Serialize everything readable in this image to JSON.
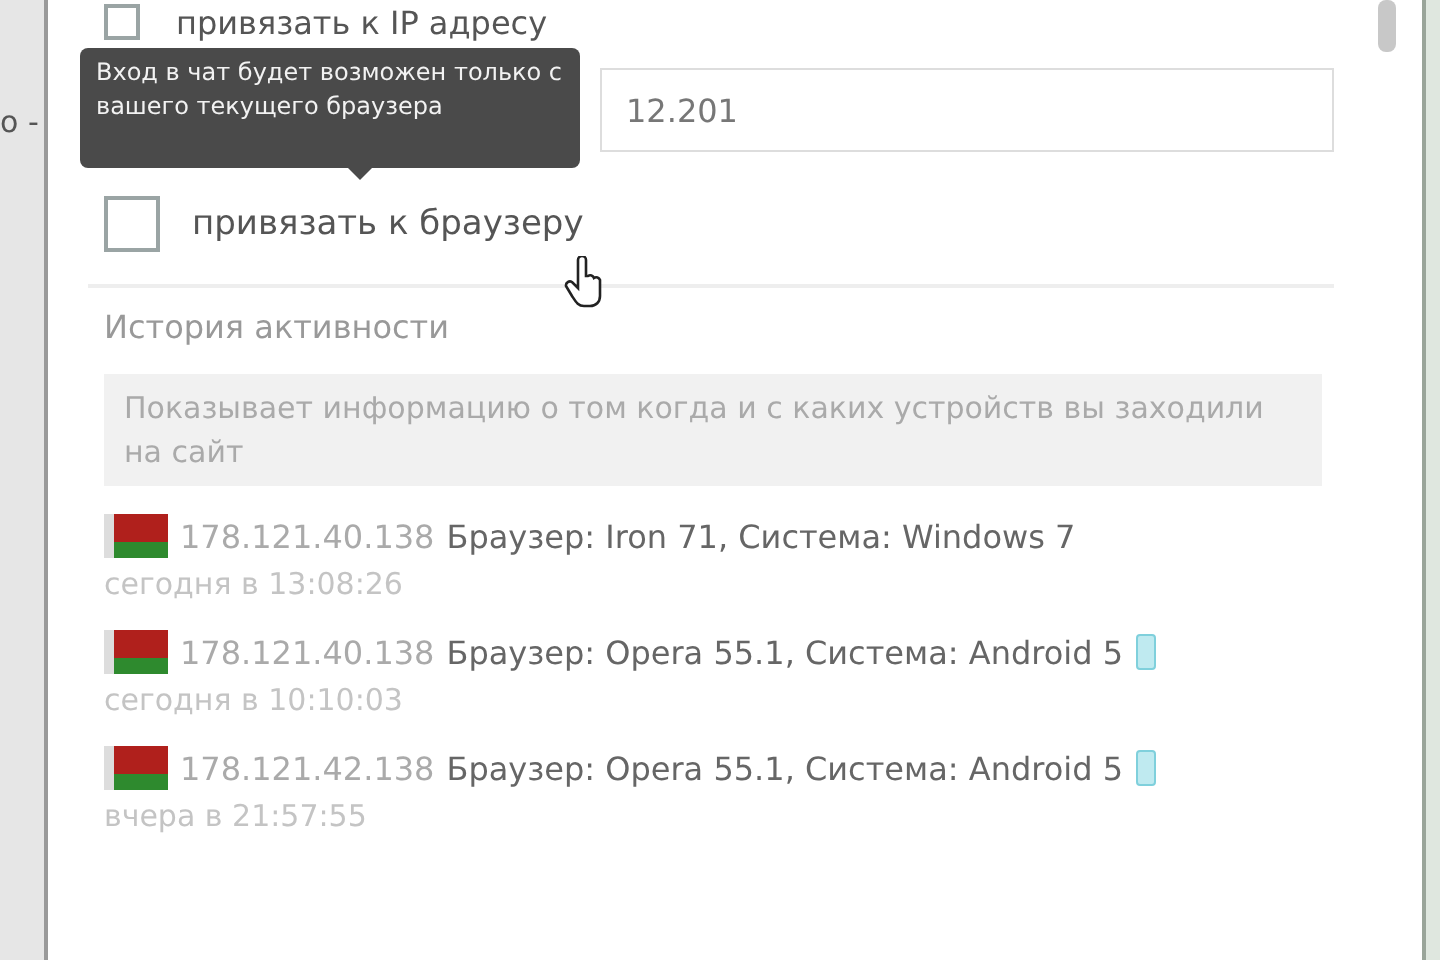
{
  "background": {
    "text": "о -"
  },
  "ip_binding": {
    "label": "привязать к IP адресу",
    "checked": false,
    "value": "12.201"
  },
  "tooltip": {
    "text": "Вход в чат будет возможен только с вашего текущего браузера"
  },
  "browser_binding": {
    "label": "привязать к браузеру",
    "checked": false
  },
  "history": {
    "title": "История активности",
    "info": "Показывает информацию о том когда и с каких устройств вы заходили на сайт",
    "entries": [
      {
        "ip": "178.121.40.138",
        "details": "Браузер: Iron 71, Система: Windows 7",
        "mobile": false,
        "time": "сегодня в 13:08:26"
      },
      {
        "ip": "178.121.40.138",
        "details": "Браузер: Opera 55.1, Система: Android 5",
        "mobile": true,
        "time": "сегодня в 10:10:03"
      },
      {
        "ip": "178.121.42.138",
        "details": "Браузер: Opera 55.1, Система: Android 5",
        "mobile": true,
        "time": "вчера в 21:57:55"
      }
    ]
  }
}
